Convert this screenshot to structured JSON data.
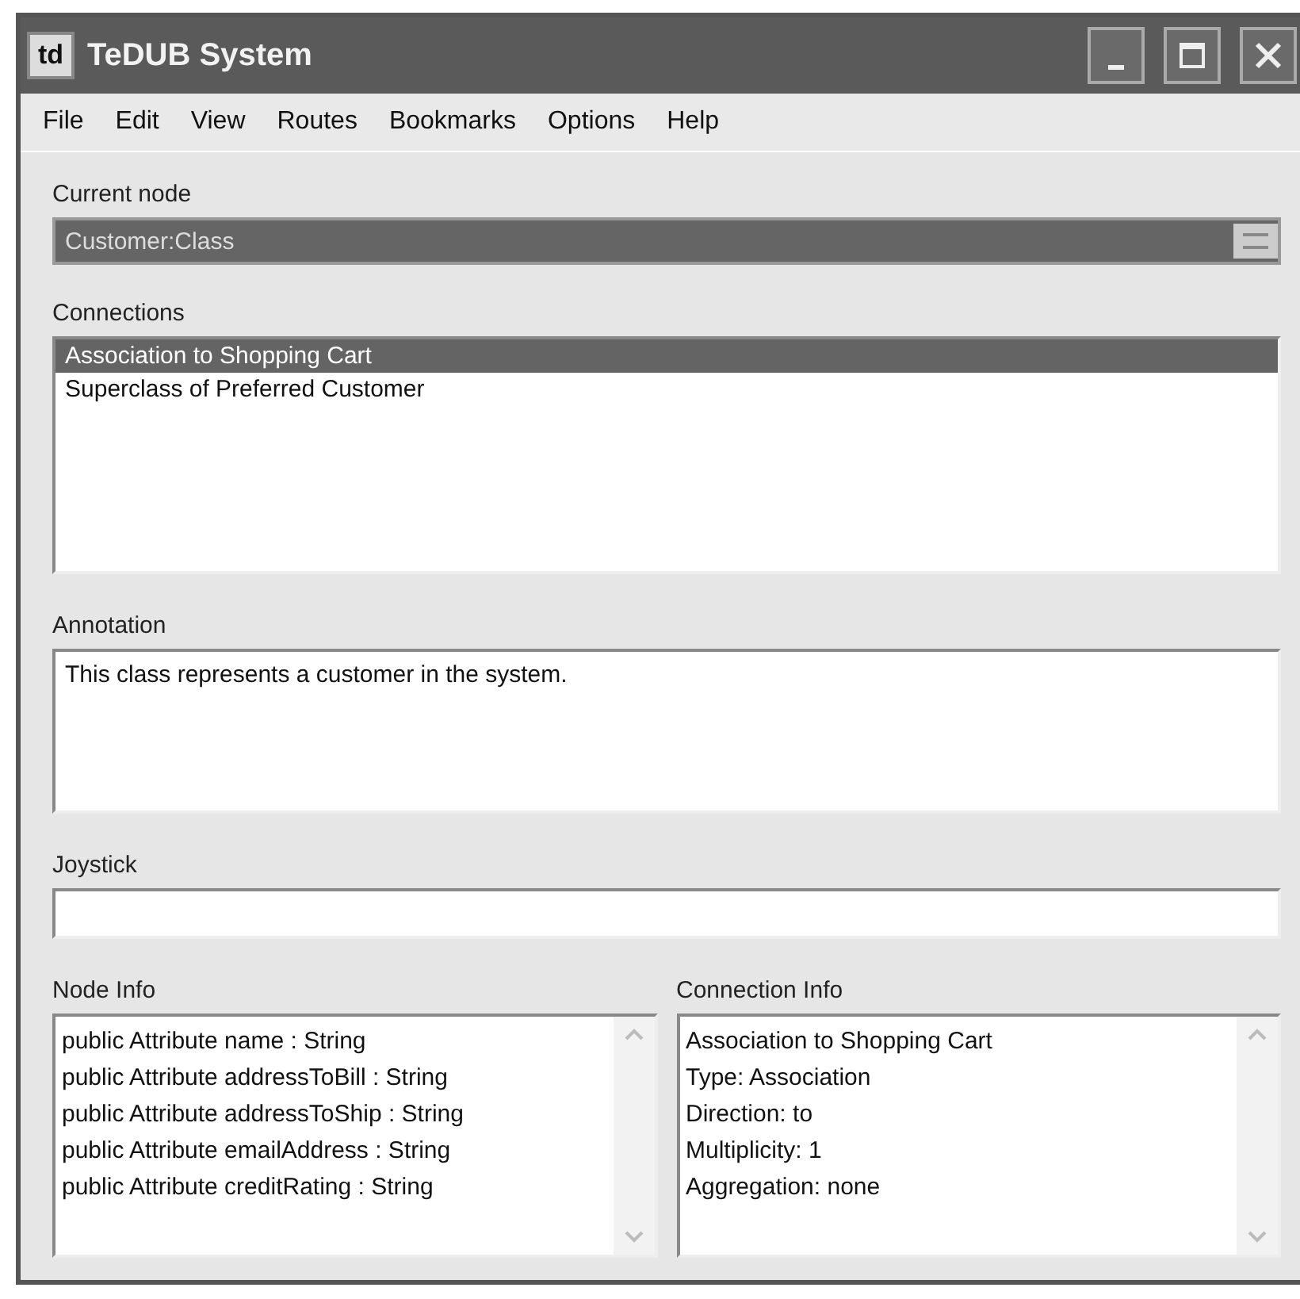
{
  "window": {
    "title": "TeDUB System",
    "app_icon": "td"
  },
  "menu": [
    "File",
    "Edit",
    "View",
    "Routes",
    "Bookmarks",
    "Options",
    "Help"
  ],
  "current_node": {
    "label": "Current node",
    "value": "Customer:Class"
  },
  "connections": {
    "label": "Connections",
    "items": [
      {
        "text": "Association to Shopping Cart",
        "selected": true
      },
      {
        "text": "Superclass of Preferred Customer",
        "selected": false
      }
    ]
  },
  "annotation": {
    "label": "Annotation",
    "value": "This class represents a customer in the system."
  },
  "joystick": {
    "label": "Joystick"
  },
  "node_info": {
    "label": "Node Info",
    "lines": [
      "public Attribute name : String",
      "public Attribute addressToBill : String",
      "public Attribute addressToShip : String",
      "public Attribute emailAddress : String",
      "public Attribute creditRating : String"
    ]
  },
  "connection_info": {
    "label": "Connection Info",
    "lines": [
      "Association to Shopping Cart",
      "Type: Association",
      "Direction: to",
      "Multiplicity: 1",
      "Aggregation: none"
    ]
  }
}
